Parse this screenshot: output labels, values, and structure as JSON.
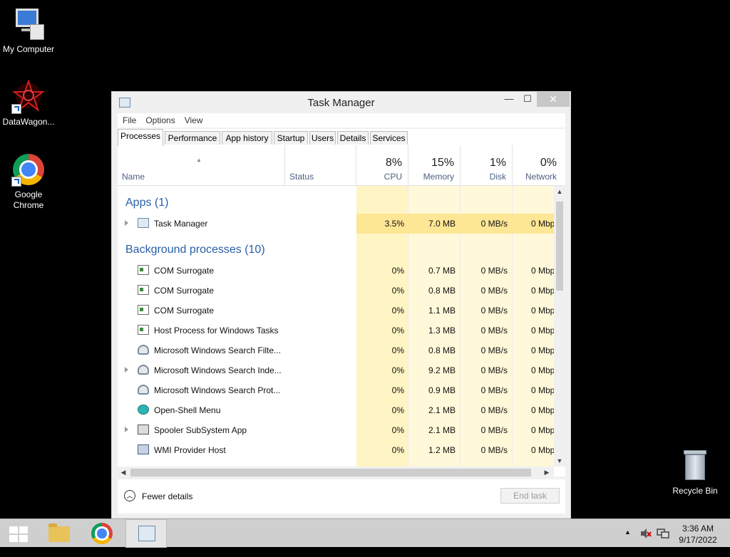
{
  "desktop": {
    "icons": [
      {
        "label": "My Computer",
        "icon": "computer-icon"
      },
      {
        "label": "DataWagon...",
        "icon": "datawagon-icon"
      },
      {
        "label": "Google Chrome",
        "icon": "chrome-icon"
      },
      {
        "label": "Recycle Bin",
        "icon": "recycle-bin-icon"
      }
    ]
  },
  "window": {
    "title": "Task Manager",
    "controls": {
      "minimize": "—",
      "maximize": "☐",
      "close": "✕"
    },
    "menu": [
      "File",
      "Options",
      "View"
    ],
    "tabs": [
      "Processes",
      "Performance",
      "App history",
      "Startup",
      "Users",
      "Details",
      "Services"
    ],
    "active_tab": "Processes",
    "columns": {
      "name": "Name",
      "status": "Status",
      "cpu": {
        "pct": "8%",
        "label": "CPU"
      },
      "memory": {
        "pct": "15%",
        "label": "Memory"
      },
      "disk": {
        "pct": "1%",
        "label": "Disk"
      },
      "network": {
        "pct": "0%",
        "label": "Network"
      }
    },
    "groups": {
      "apps": "Apps (1)",
      "background": "Background processes (10)"
    },
    "apps": [
      {
        "name": "Task Manager",
        "icon": "task-manager-icon",
        "expandable": true,
        "cpu": "3.5%",
        "memory": "7.0 MB",
        "disk": "0 MB/s",
        "network": "0 Mbp"
      }
    ],
    "background": [
      {
        "name": "COM Surrogate",
        "icon": "process-icon",
        "expandable": false,
        "cpu": "0%",
        "memory": "0.7 MB",
        "disk": "0 MB/s",
        "network": "0 Mbp"
      },
      {
        "name": "COM Surrogate",
        "icon": "process-icon",
        "expandable": false,
        "cpu": "0%",
        "memory": "0.8 MB",
        "disk": "0 MB/s",
        "network": "0 Mbp"
      },
      {
        "name": "COM Surrogate",
        "icon": "process-icon",
        "expandable": false,
        "cpu": "0%",
        "memory": "1.1 MB",
        "disk": "0 MB/s",
        "network": "0 Mbp"
      },
      {
        "name": "Host Process for Windows Tasks",
        "icon": "process-icon",
        "expandable": false,
        "cpu": "0%",
        "memory": "1.3 MB",
        "disk": "0 MB/s",
        "network": "0 Mbp"
      },
      {
        "name": "Microsoft Windows Search Filte...",
        "icon": "search-user-icon",
        "expandable": false,
        "cpu": "0%",
        "memory": "0.8 MB",
        "disk": "0 MB/s",
        "network": "0 Mbp"
      },
      {
        "name": "Microsoft Windows Search Inde...",
        "icon": "search-user-icon",
        "expandable": true,
        "cpu": "0%",
        "memory": "9.2 MB",
        "disk": "0 MB/s",
        "network": "0 Mbp"
      },
      {
        "name": "Microsoft Windows Search Prot...",
        "icon": "search-user-icon",
        "expandable": false,
        "cpu": "0%",
        "memory": "0.9 MB",
        "disk": "0 MB/s",
        "network": "0 Mbp"
      },
      {
        "name": "Open-Shell Menu",
        "icon": "shell-icon",
        "expandable": false,
        "cpu": "0%",
        "memory": "2.1 MB",
        "disk": "0 MB/s",
        "network": "0 Mbp"
      },
      {
        "name": "Spooler SubSystem App",
        "icon": "printer-icon",
        "expandable": true,
        "cpu": "0%",
        "memory": "2.1 MB",
        "disk": "0 MB/s",
        "network": "0 Mbp"
      },
      {
        "name": "WMI Provider Host",
        "icon": "wmi-icon",
        "expandable": false,
        "cpu": "0%",
        "memory": "1.2 MB",
        "disk": "0 MB/s",
        "network": "0 Mbp"
      }
    ],
    "footer": {
      "fewer_details": "Fewer details",
      "end_task": "End task"
    }
  },
  "taskbar": {
    "items": [
      "start-button",
      "file-explorer",
      "google-chrome",
      "task-manager"
    ],
    "tray": {
      "time": "3:36 AM",
      "date": "9/17/2022"
    }
  }
}
